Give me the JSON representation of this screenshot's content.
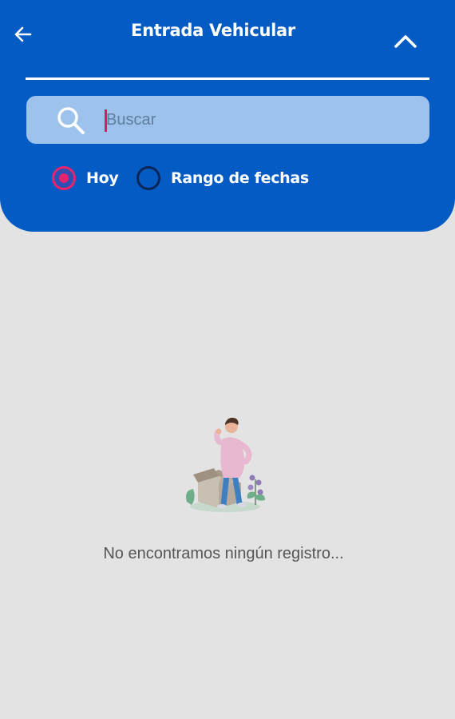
{
  "header": {
    "title": "Entrada Vehicular",
    "back_icon": "arrow-left-icon",
    "collapse_icon": "chevron-up-icon",
    "background_color": "#055bc4"
  },
  "search": {
    "placeholder": "Buscar",
    "value": "",
    "icon": "search-icon",
    "background_color": "#9dc3ec"
  },
  "filter": {
    "options": [
      {
        "label": "Hoy",
        "selected": true
      },
      {
        "label": "Rango de fechas",
        "selected": false
      }
    ],
    "accent_color": "#e8246f"
  },
  "empty_state": {
    "message": "No encontramos ningún registro...",
    "illustration": "person-with-empty-box-illustration"
  }
}
